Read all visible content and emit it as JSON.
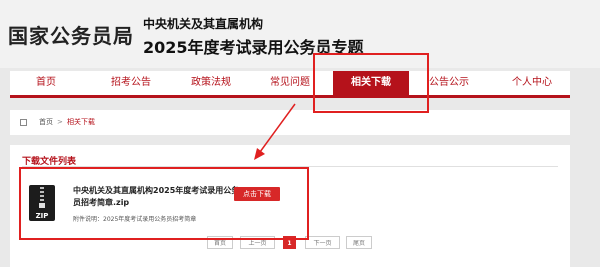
{
  "header": {
    "logo": "国家公务员局",
    "subtitle_1": "中央机关及其直属机构",
    "subtitle_2": "2025年度考试录用公务员专题"
  },
  "nav": {
    "items": [
      {
        "label": "首页",
        "active": false
      },
      {
        "label": "招考公告",
        "active": false
      },
      {
        "label": "政策法规",
        "active": false
      },
      {
        "label": "常见问题",
        "active": false
      },
      {
        "label": "相关下载",
        "active": true
      },
      {
        "label": "公告公示",
        "active": false
      },
      {
        "label": "个人中心",
        "active": false
      }
    ]
  },
  "breadcrumb": {
    "home": "首页",
    "separator": ">",
    "current": "相关下载"
  },
  "section": {
    "title": "下载文件列表"
  },
  "file": {
    "name": "中央机关及其直属机构2025年度考试录用公务员招考简章.zip",
    "description": "附件说明：2025年度考试录用公务员招考简章",
    "download_label": "点击下载",
    "icon": "zip-file-icon"
  },
  "pagination": {
    "first": "首页",
    "prev": "上一页",
    "current": "1",
    "next": "下一页",
    "last": "尾页"
  },
  "colors": {
    "brand_red": "#b5121b",
    "button_red": "#d72828",
    "annotation_red": "#e02020"
  }
}
